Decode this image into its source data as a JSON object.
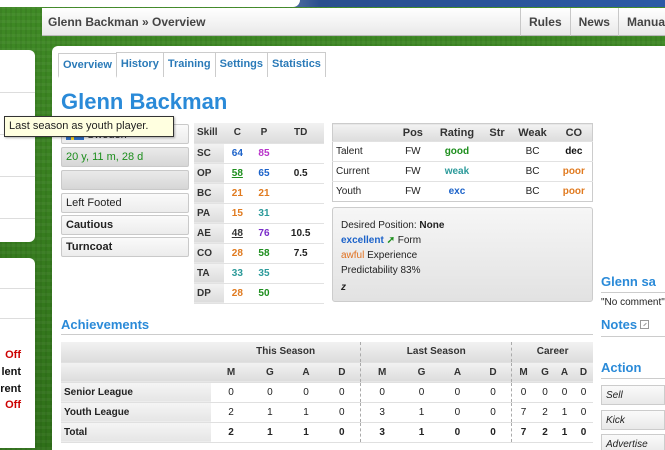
{
  "header": {
    "breadcrumb": "Glenn Backman » Overview",
    "nav": [
      "Rules",
      "News",
      "Manua"
    ]
  },
  "left_panel": {
    "stubs": [
      {
        "text": "Off",
        "color": "#cc0000"
      },
      {
        "text": "lent",
        "color": "#111111"
      },
      {
        "text": "rent",
        "color": "#111111"
      },
      {
        "text": "Off",
        "color": "#cc0000"
      }
    ]
  },
  "tabs": [
    "Overview",
    "History",
    "Training",
    "Settings",
    "Statistics"
  ],
  "player": {
    "name": "Glenn Backman",
    "country": "Sweden",
    "age": "20 y, 11 m, 28 d",
    "tooltip": "Last season as youth player.",
    "foot": "Left Footed",
    "trait1": "Cautious",
    "trait2": "Turncoat"
  },
  "skills": {
    "headers": [
      "Skill",
      "C",
      "P",
      "TD"
    ],
    "rows": [
      {
        "skill": "SC",
        "c": "64",
        "c_color": "#1b62c9",
        "p": "85",
        "p_color": "#b832c9",
        "td": "",
        "c_under": false
      },
      {
        "skill": "OP",
        "c": "58",
        "c_color": "#1c8e1c",
        "p": "65",
        "p_color": "#1b62c9",
        "td": "0.5",
        "c_under": true
      },
      {
        "skill": "BC",
        "c": "21",
        "c_color": "#e07a1f",
        "p": "21",
        "p_color": "#e07a1f",
        "td": "",
        "c_under": false
      },
      {
        "skill": "PA",
        "c": "15",
        "c_color": "#e07a1f",
        "p": "31",
        "p_color": "#2b9a9a",
        "td": "",
        "c_under": false
      },
      {
        "skill": "AE",
        "c": "48",
        "c_color": "#333333",
        "p": "76",
        "p_color": "#7a2bc9",
        "td": "10.5",
        "c_under": true
      },
      {
        "skill": "CO",
        "c": "28",
        "c_color": "#e07a1f",
        "p": "58",
        "p_color": "#1c8e1c",
        "td": "7.5",
        "c_under": false
      },
      {
        "skill": "TA",
        "c": "33",
        "c_color": "#2b9a9a",
        "p": "35",
        "p_color": "#2b9a9a",
        "td": "",
        "c_under": false
      },
      {
        "skill": "DP",
        "c": "28",
        "c_color": "#e07a1f",
        "p": "50",
        "p_color": "#1c8e1c",
        "td": "",
        "c_under": false
      }
    ]
  },
  "ratings": {
    "headers": [
      "",
      "Pos",
      "Rating",
      "Str",
      "Weak",
      "CO"
    ],
    "rows": [
      {
        "label": "Talent",
        "pos": "FW",
        "rating": "good",
        "rating_color": "#1c8e1c",
        "str": "",
        "weak": "BC",
        "co": "dec",
        "co_color": "#111111"
      },
      {
        "label": "Current",
        "pos": "FW",
        "rating": "weak",
        "rating_color": "#2b9a9a",
        "str": "",
        "weak": "BC",
        "co": "poor",
        "co_color": "#e07a1f"
      },
      {
        "label": "Youth",
        "pos": "FW",
        "rating": "exc",
        "rating_color": "#1b62c9",
        "str": "",
        "weak": "BC",
        "co": "poor",
        "co_color": "#e07a1f"
      }
    ]
  },
  "desired": {
    "position_label": "Desired Position:",
    "position_value": "None",
    "form_value": "excellent",
    "form_label": "Form",
    "experience_value": "awful",
    "experience_label": "Experience",
    "predictability": "Predictability 83%",
    "sleep": "z"
  },
  "achievements": {
    "title": "Achievements",
    "groups": [
      "This Season",
      "Last Season",
      "Career"
    ],
    "subheaders": [
      "M",
      "G",
      "A",
      "D"
    ],
    "rows": [
      {
        "label": "Senior League",
        "values": [
          "0",
          "0",
          "0",
          "0",
          "0",
          "0",
          "0",
          "0",
          "0",
          "0",
          "0",
          "0"
        ]
      },
      {
        "label": "Youth League",
        "values": [
          "2",
          "1",
          "1",
          "0",
          "3",
          "1",
          "0",
          "0",
          "7",
          "2",
          "1",
          "0"
        ]
      },
      {
        "label": "Total",
        "values": [
          "2",
          "1",
          "1",
          "0",
          "3",
          "1",
          "0",
          "0",
          "7",
          "2",
          "1",
          "0"
        ],
        "total": true
      }
    ]
  },
  "right_column": {
    "glenn_title": "Glenn sa",
    "no_comment": "\"No comment\"",
    "notes_title": "Notes",
    "action_title": "Action",
    "actions": [
      "Sell",
      "Kick",
      "Advertise"
    ]
  }
}
